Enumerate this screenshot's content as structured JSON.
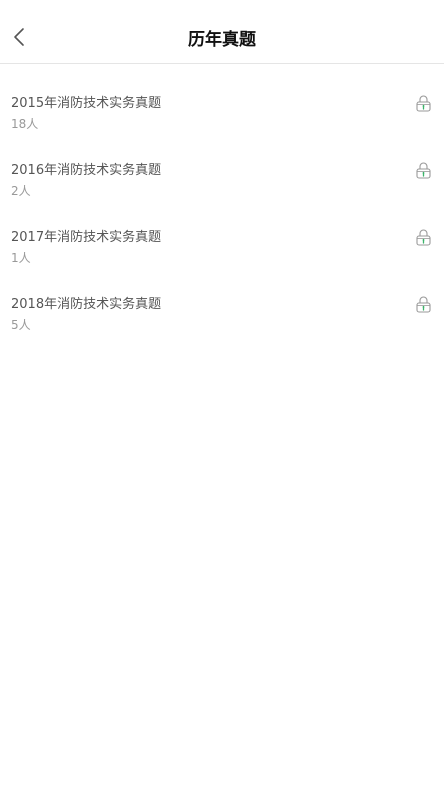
{
  "header": {
    "title": "历年真题"
  },
  "icons": {
    "back": "chevron-left-icon",
    "lock": "lock-icon"
  },
  "colors": {
    "lock_accent": "#3bb36a",
    "title_text": "#555555",
    "count_text": "#999999",
    "divider": "#e5e5e5"
  },
  "items": [
    {
      "title": "2015年消防技术实务真题",
      "count": "18人"
    },
    {
      "title": "2016年消防技术实务真题",
      "count": "2人"
    },
    {
      "title": "2017年消防技术实务真题",
      "count": "1人"
    },
    {
      "title": "2018年消防技术实务真题",
      "count": "5人"
    }
  ]
}
